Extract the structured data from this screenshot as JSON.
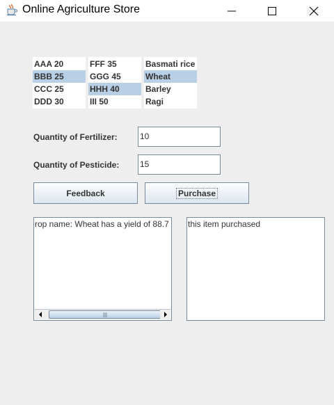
{
  "window": {
    "title": "Online Agriculture Store",
    "icon": "java-coffee-cup-icon",
    "controls": {
      "minimize": "minimize-icon",
      "maximize": "maximize-icon",
      "close": "close-icon"
    }
  },
  "lists": {
    "fertilizers": {
      "items": [
        "AAA 20",
        "BBB 25",
        "CCC 25",
        "DDD 30"
      ],
      "selected": "BBB 25"
    },
    "pesticides": {
      "items": [
        "FFF 35",
        "GGG 45",
        "HHH 40",
        "III 50"
      ],
      "selected": "HHH 40"
    },
    "crops": {
      "items": [
        "Basmati rice",
        "Wheat",
        "Barley",
        "Ragi"
      ],
      "selected": "Wheat"
    }
  },
  "form": {
    "fertilizer_label": "Quantity of Fertilizer:",
    "fertilizer_value": "10",
    "pesticide_label": "Quantity of Pesticide:",
    "pesticide_value": "15"
  },
  "buttons": {
    "feedback": "Feedback",
    "purchase": "Purchase"
  },
  "output": {
    "crop_info": "rop name: Wheat has a yield of 88.7",
    "purchase_status": "this item purchased"
  },
  "colors": {
    "selection": "#b8cfe5",
    "background": "#eeeeee",
    "border": "#7a8a99"
  }
}
